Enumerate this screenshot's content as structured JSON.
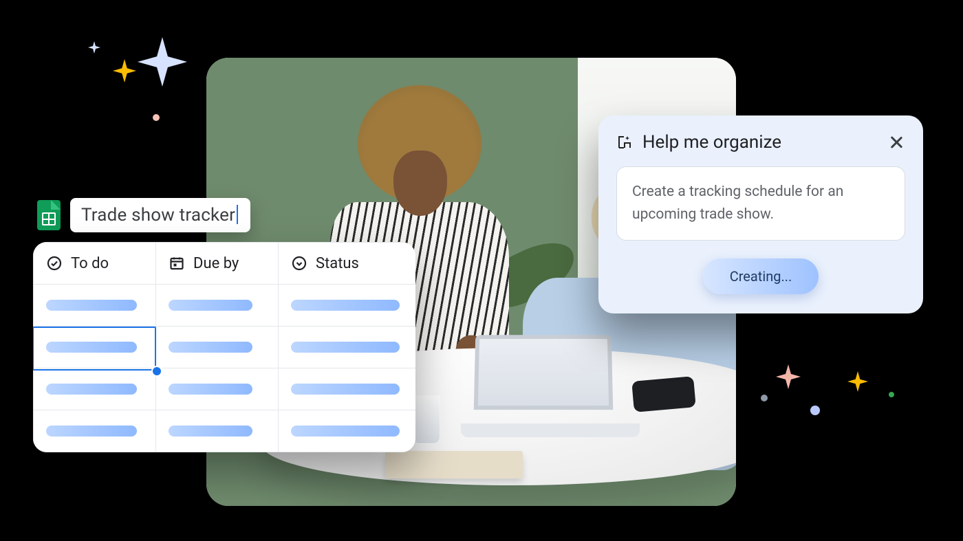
{
  "doc": {
    "title": "Trade show tracker"
  },
  "sheet": {
    "columns": [
      {
        "icon": "check-circle",
        "label": "To do"
      },
      {
        "icon": "calendar",
        "label": "Due by"
      },
      {
        "icon": "status",
        "label": "Status"
      }
    ],
    "rows": 4,
    "selected": {
      "row": 1,
      "col": 0
    }
  },
  "panel": {
    "title": "Help me organize",
    "prompt": "Create a tracking schedule for an upcoming trade show.",
    "button": "Creating..."
  }
}
